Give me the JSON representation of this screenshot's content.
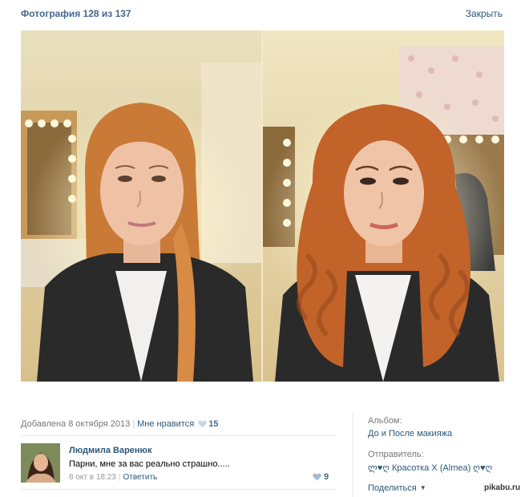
{
  "header": {
    "title": "Фотография 128 из 137",
    "close_label": "Закрыть"
  },
  "photo_info": {
    "added": "Добавлена 8 октября 2013",
    "like_label": "Мне нравится",
    "like_count": "15"
  },
  "comment": {
    "author": "Людмила Варенюк",
    "text": "Парни, мне за вас реально страшно.....",
    "time": "8 окт в 18:23",
    "reply_label": "Ответить",
    "likes": "9"
  },
  "sidebar": {
    "album_label": "Альбом:",
    "album_name": "До и После макияжа",
    "sender_label": "Отправитель:",
    "sender_name": "ლ♥ღ Красотка X (Almea) ღ♥ღ",
    "share_label": "Поделиться"
  },
  "watermark": "pikabu.ru",
  "colors": {
    "link": "#2b587a",
    "header": "#45688e",
    "muted": "#777777",
    "heart": "#a4bbd3"
  },
  "icons": [
    "heart-icon",
    "chevron-down-icon"
  ]
}
